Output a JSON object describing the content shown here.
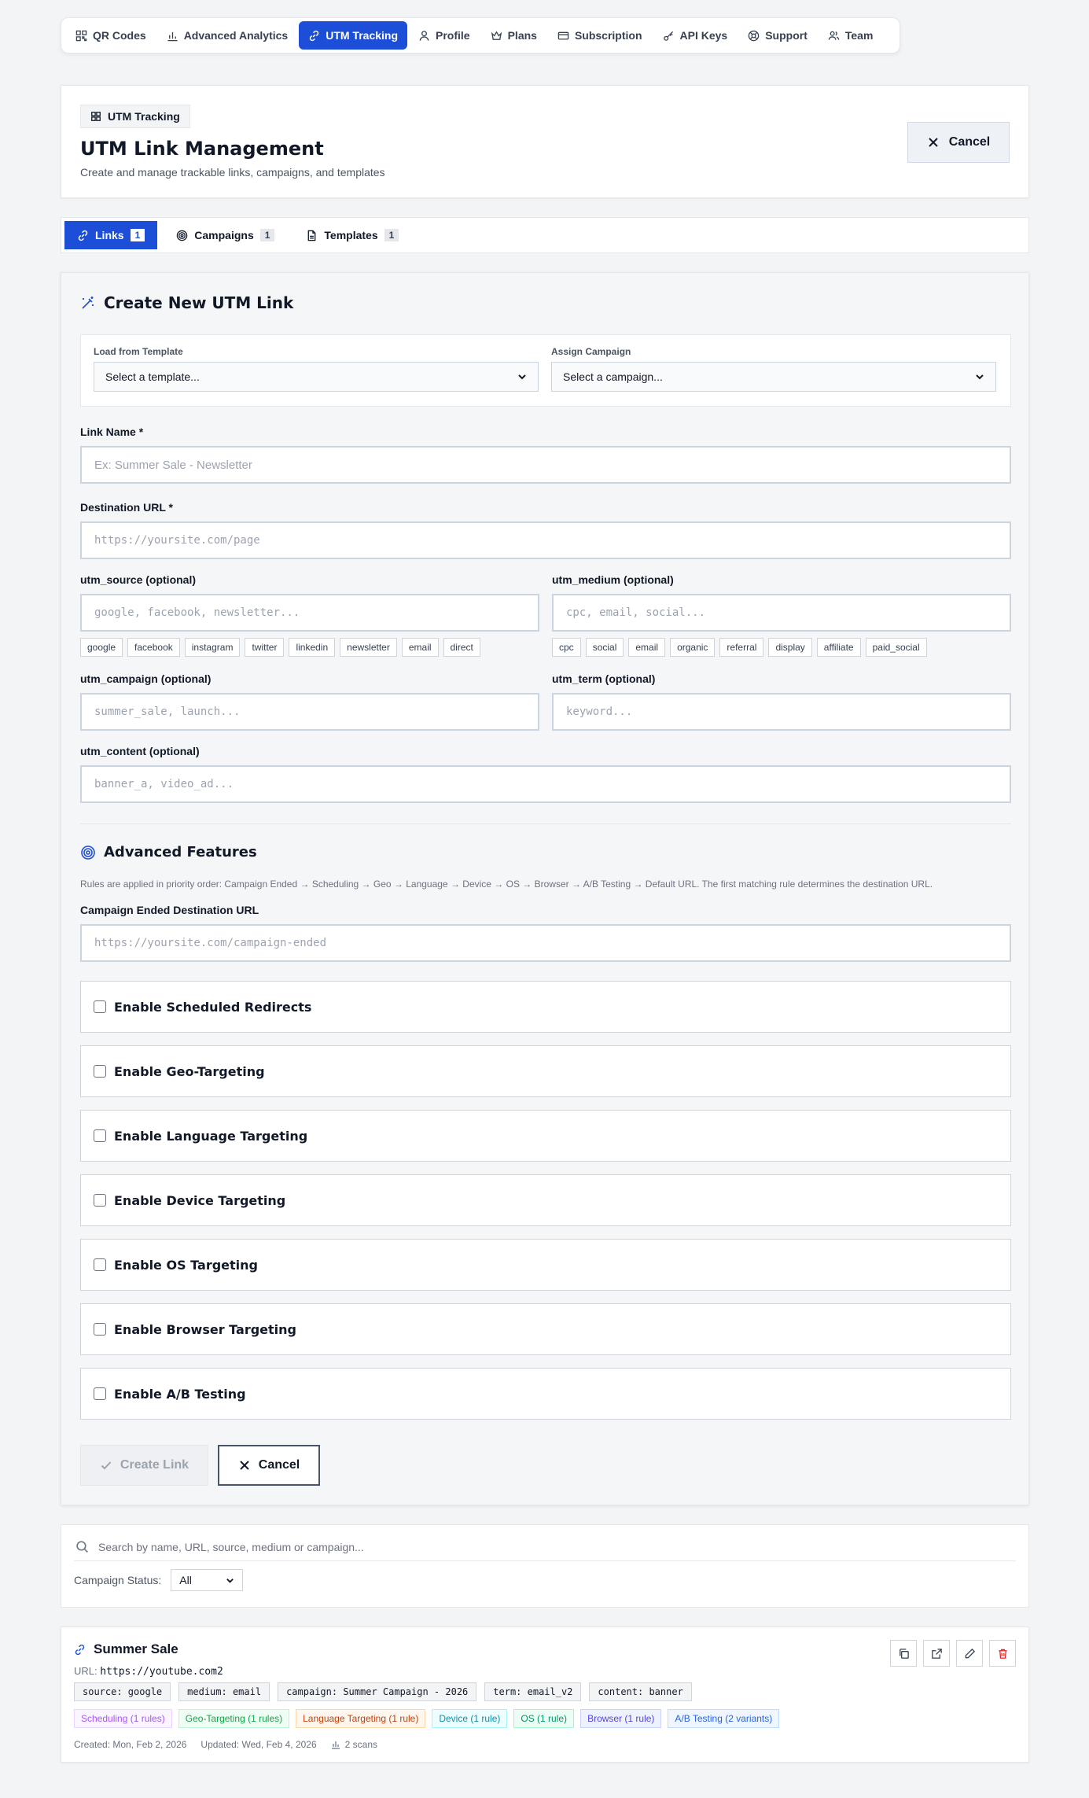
{
  "nav": {
    "items": [
      {
        "label": "QR Codes",
        "icon": "qr-code-icon"
      },
      {
        "label": "Advanced Analytics",
        "icon": "bar-chart-icon"
      },
      {
        "label": "UTM Tracking",
        "icon": "link-icon"
      },
      {
        "label": "Profile",
        "icon": "user-icon"
      },
      {
        "label": "Plans",
        "icon": "crown-icon"
      },
      {
        "label": "Subscription",
        "icon": "credit-card-icon"
      },
      {
        "label": "API Keys",
        "icon": "key-icon"
      },
      {
        "label": "Support",
        "icon": "lifebuoy-icon"
      },
      {
        "label": "Team",
        "icon": "users-icon"
      }
    ],
    "active_index": 2
  },
  "header": {
    "badge": "UTM Tracking",
    "title": "UTM Link Management",
    "subtitle": "Create and manage trackable links, campaigns, and templates",
    "cancel_label": "Cancel"
  },
  "tabs": [
    {
      "label": "Links",
      "count": "1"
    },
    {
      "label": "Campaigns",
      "count": "1"
    },
    {
      "label": "Templates",
      "count": "1"
    }
  ],
  "form": {
    "title": "Create New UTM Link",
    "template_label": "Load from Template",
    "template_value": "Select a template...",
    "campaign_label": "Assign Campaign",
    "campaign_value": "Select a campaign...",
    "link_name_label": "Link Name *",
    "link_name_placeholder": "Ex: Summer Sale - Newsletter",
    "dest_label": "Destination URL *",
    "dest_placeholder": "https://yoursite.com/page",
    "source_label": "utm_source (optional)",
    "source_placeholder": "google, facebook, newsletter...",
    "source_chips": [
      "google",
      "facebook",
      "instagram",
      "twitter",
      "linkedin",
      "newsletter",
      "email",
      "direct"
    ],
    "medium_label": "utm_medium (optional)",
    "medium_placeholder": "cpc, email, social...",
    "medium_chips": [
      "cpc",
      "social",
      "email",
      "organic",
      "referral",
      "display",
      "affiliate",
      "paid_social"
    ],
    "campaign_field_label": "utm_campaign (optional)",
    "campaign_field_placeholder": "summer_sale, launch...",
    "term_label": "utm_term (optional)",
    "term_placeholder": "keyword...",
    "content_label": "utm_content (optional)",
    "content_placeholder": "banner_a, video_ad...",
    "advanced_title": "Advanced Features",
    "advanced_hint": "Rules are applied in priority order: Campaign Ended → Scheduling → Geo → Language → Device → OS → Browser → A/B Testing → Default URL. The first matching rule determines the destination URL.",
    "ended_label": "Campaign Ended Destination URL",
    "ended_placeholder": "https://yoursite.com/campaign-ended",
    "toggles": [
      "Enable Scheduled Redirects",
      "Enable Geo-Targeting",
      "Enable Language Targeting",
      "Enable Device Targeting",
      "Enable OS Targeting",
      "Enable Browser Targeting",
      "Enable A/B Testing"
    ],
    "create_label": "Create Link",
    "cancel_label": "Cancel"
  },
  "search": {
    "placeholder": "Search by name, URL, source, medium or campaign...",
    "status_label": "Campaign Status:",
    "status_value": "All"
  },
  "link": {
    "name": "Summer Sale",
    "url_prefix": "URL:",
    "url": "https://youtube.com2",
    "params": [
      "source: google",
      "medium: email",
      "campaign: Summer Campaign - 2026",
      "term: email_v2",
      "content: banner"
    ],
    "rules": [
      {
        "label": "Scheduling (1 rules)",
        "color": "#a855f7"
      },
      {
        "label": "Geo-Targeting (1 rules)",
        "color": "#16a34a"
      },
      {
        "label": "Language Targeting (1 rule)",
        "color": "#c2410c"
      },
      {
        "label": "Device (1 rule)",
        "color": "#0891b2"
      },
      {
        "label": "OS (1 rule)",
        "color": "#059669"
      },
      {
        "label": "Browser (1 rule)",
        "color": "#4f46e5"
      },
      {
        "label": "A/B Testing (2 variants)",
        "color": "#2563eb"
      }
    ],
    "created": "Created: Mon, Feb 2, 2026",
    "updated": "Updated: Wed, Feb 4, 2026",
    "scans": "2 scans"
  }
}
